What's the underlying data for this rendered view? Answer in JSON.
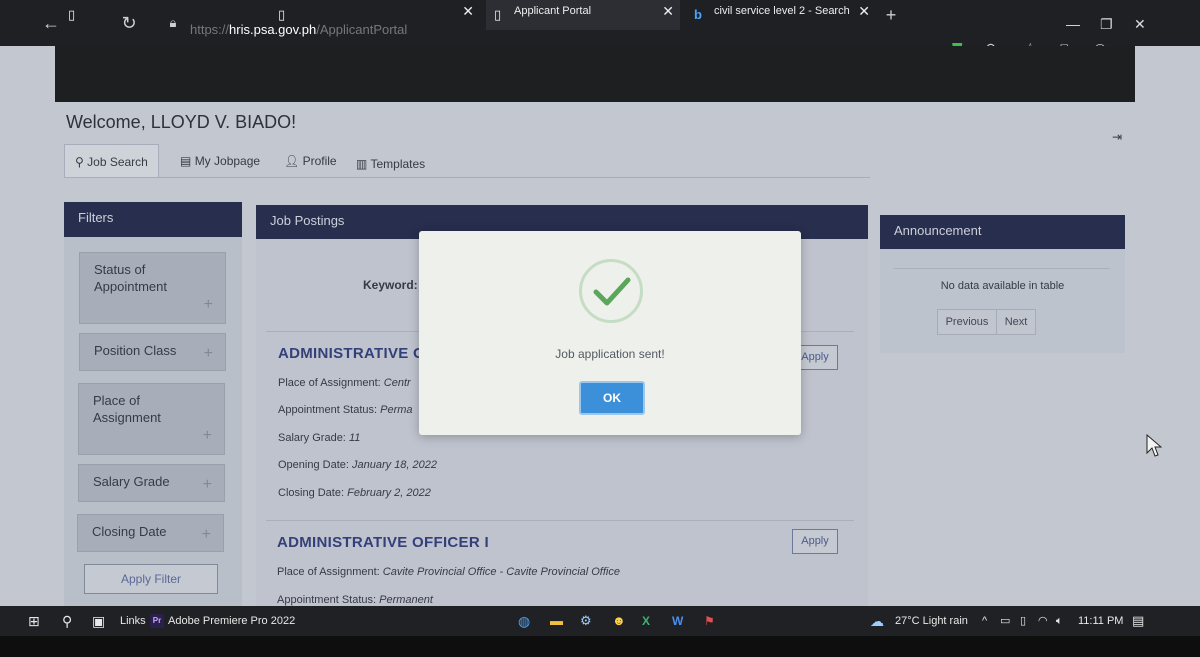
{
  "browser": {
    "tabs": [
      {
        "title": "",
        "icon": "page-icon"
      },
      {
        "title": "",
        "icon": "page-icon"
      },
      {
        "title": "Applicant Portal",
        "icon": "page-icon",
        "active": true
      },
      {
        "title": "civil service level 2 - Search",
        "icon": "bing-icon"
      }
    ],
    "new_tab_label": "+",
    "url_host": "hris.psa.gov.ph",
    "url_path_prefix": "https://",
    "url_path": "/ApplicantPortal"
  },
  "page": {
    "welcome": "Welcome, LLOYD V. BIADO!",
    "tabs": [
      {
        "label": "Job Search",
        "icon": "search-icon"
      },
      {
        "label": "My Jobpage",
        "icon": "document-icon"
      },
      {
        "label": "Profile",
        "icon": "user-icon"
      },
      {
        "label": "Templates",
        "icon": "template-icon"
      }
    ],
    "filters": {
      "title": "Filters",
      "items": [
        "Status of Appointment",
        "Position Class",
        "Place of Assignment",
        "Salary Grade",
        "Closing Date"
      ],
      "plus": "+",
      "apply_label": "Apply Filter"
    },
    "postings": {
      "title": "Job Postings",
      "keyword_label": "Keyword:",
      "jobs": [
        {
          "title": "ADMINISTRATIVE O",
          "apply": "Apply",
          "place_label": "Place of Assignment:",
          "place": "Centr",
          "status_label": "Appointment Status:",
          "status": "Perma",
          "salary_label": "Salary Grade:",
          "salary": "11",
          "opening_label": "Opening Date:",
          "opening": "January 18, 2022",
          "closing_label": "Closing Date:",
          "closing": "February 2, 2022"
        },
        {
          "title": "ADMINISTRATIVE OFFICER I",
          "apply": "Apply",
          "place_label": "Place of Assignment:",
          "place": "Cavite Provincial Office - Cavite Provincial Office",
          "status_label": "Appointment Status:",
          "status": "Permanent"
        }
      ]
    },
    "announcement": {
      "title": "Announcement",
      "empty": "No data available in table",
      "previous": "Previous",
      "next": "Next"
    }
  },
  "modal": {
    "message": "Job application sent!",
    "ok": "OK",
    "check_color": "#5aa65a"
  },
  "taskbar": {
    "links": "Links",
    "premiere": "Adobe Premiere Pro 2022",
    "premiere_icon_text": "Pr",
    "weather": "27°C  Light rain",
    "time": "11:11 PM"
  }
}
